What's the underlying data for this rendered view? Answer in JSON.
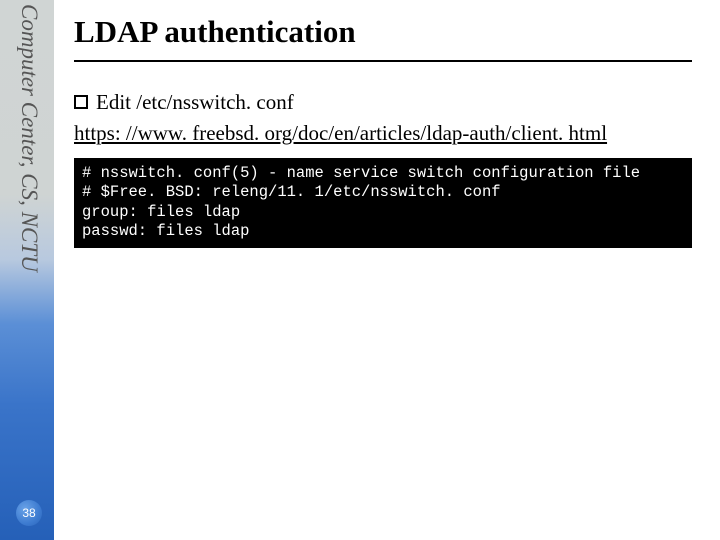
{
  "sidebar": {
    "org_text": "Computer Center, CS, NCTU",
    "page_number": "38"
  },
  "slide": {
    "title": "LDAP authentication",
    "bullet1": "Edit /etc/nsswitch. conf",
    "link_text": "https: //www. freebsd. org/doc/en/articles/ldap-auth/client. html",
    "code": "# nsswitch. conf(5) - name service switch configuration file\n# $Free. BSD: releng/11. 1/etc/nsswitch. conf\ngroup: files ldap\npasswd: files ldap"
  }
}
